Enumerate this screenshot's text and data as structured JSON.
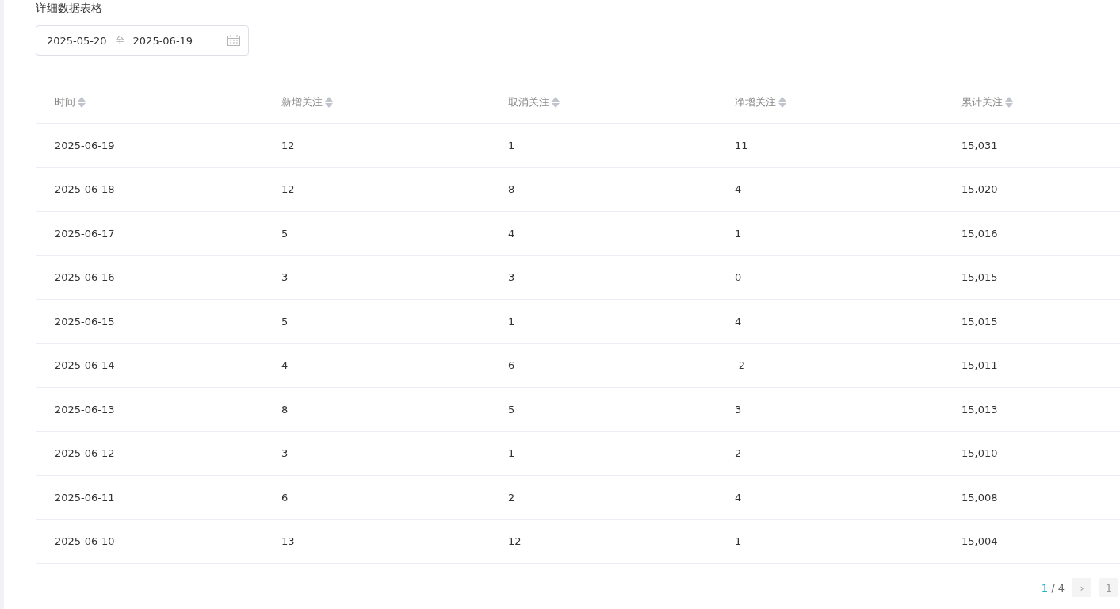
{
  "title": "详细数据表格",
  "date_range": {
    "start": "2025-05-20",
    "separator": "至",
    "end": "2025-06-19"
  },
  "table": {
    "columns": [
      "时间",
      "新增关注",
      "取消关注",
      "净增关注",
      "累计关注"
    ],
    "rows": [
      [
        "2025-06-19",
        "12",
        "1",
        "11",
        "15,031"
      ],
      [
        "2025-06-18",
        "12",
        "8",
        "4",
        "15,020"
      ],
      [
        "2025-06-17",
        "5",
        "4",
        "1",
        "15,016"
      ],
      [
        "2025-06-16",
        "3",
        "3",
        "0",
        "15,015"
      ],
      [
        "2025-06-15",
        "5",
        "1",
        "4",
        "15,015"
      ],
      [
        "2025-06-14",
        "4",
        "6",
        "-2",
        "15,011"
      ],
      [
        "2025-06-13",
        "8",
        "5",
        "3",
        "15,013"
      ],
      [
        "2025-06-12",
        "3",
        "1",
        "2",
        "15,010"
      ],
      [
        "2025-06-11",
        "6",
        "2",
        "4",
        "15,008"
      ],
      [
        "2025-06-10",
        "13",
        "12",
        "1",
        "15,004"
      ]
    ]
  },
  "pagination": {
    "current": "1",
    "separator": "/",
    "total": "4",
    "next": "›",
    "page_jump": "1"
  }
}
